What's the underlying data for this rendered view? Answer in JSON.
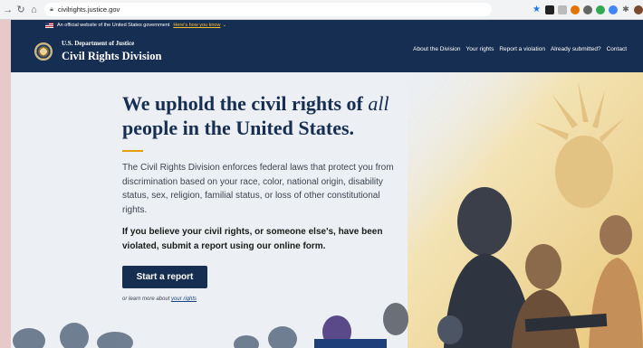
{
  "browser": {
    "url": "civilrights.justice.gov"
  },
  "gov_banner": {
    "text": "An official website of the United States government",
    "link": "Here's how you know"
  },
  "header": {
    "department": "U.S. Department of Justice",
    "division": "Civil Rights Division",
    "nav": [
      "About the Division",
      "Your rights",
      "Report a violation",
      "Already submitted?",
      "Contact"
    ]
  },
  "hero": {
    "headline_pre": "We uphold the civil rights of ",
    "headline_em": "all",
    "headline_post": " people in the United States.",
    "lead": "The Civil Rights Division enforces federal laws that protect you from discrimination based on your race, color, national origin, disability status, sex, religion, familial status, or loss of other constitutional rights.",
    "cta_text": "If you believe your civil rights, or someone else's, have been violated, submit a report using our online form.",
    "button": "Start a report",
    "learn_pre": "or learn more about ",
    "learn_link": "your rights"
  },
  "colors": {
    "navy": "#162e51",
    "accent": "#e5a000"
  }
}
